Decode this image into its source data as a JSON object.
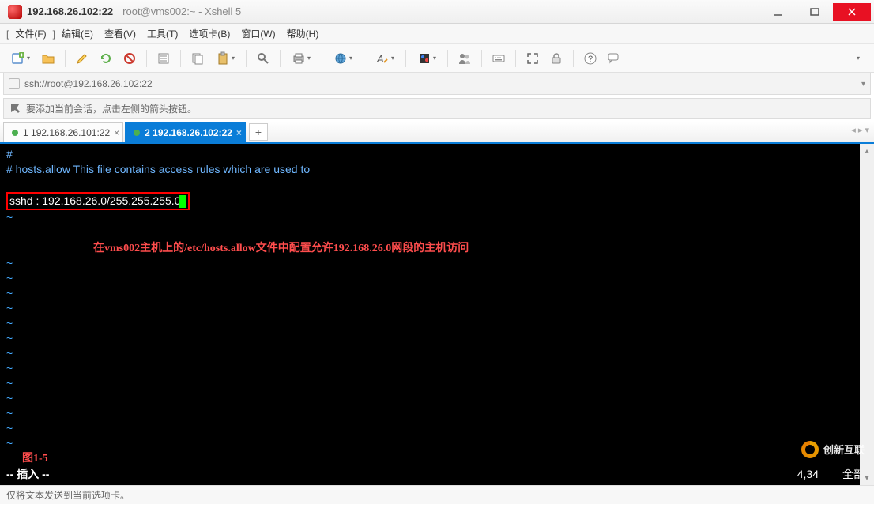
{
  "window": {
    "title_host": "192.168.26.102:22",
    "title_session": "root@vms002:~ - Xshell 5"
  },
  "menu": {
    "bracket_l": "[",
    "bracket_r": "]",
    "file": "文件(F)",
    "edit": "编辑(E)",
    "view": "查看(V)",
    "tools": "工具(T)",
    "tab": "选项卡(B)",
    "window": "窗口(W)",
    "help": "帮助(H)"
  },
  "address": {
    "url": "ssh://root@192.168.26.102:22"
  },
  "hint": {
    "text": "要添加当前会话，点击左侧的箭头按钮。"
  },
  "tabs": {
    "tab1": {
      "num": "1",
      "label": "192.168.26.101:22"
    },
    "tab2": {
      "num": "2",
      "label": "192.168.26.102:22"
    },
    "add": "+"
  },
  "terminal": {
    "line1": "#",
    "line2_a": "# hosts.allow",
    "line2_b": "   This file contains access rules which are used to",
    "hl": "sshd : 192.168.26.0/255.255.255.0",
    "annotation": "在vms002主机上的/etc/hosts.allow文件中配置允许192.168.26.0网段的主机访问",
    "figlabel": "图1-5",
    "mode": "-- 插入 --",
    "pos": "4,34",
    "all": "全部"
  },
  "status": {
    "text": "仅将文本发送到当前选项卡。"
  },
  "watermark": "创新互联"
}
